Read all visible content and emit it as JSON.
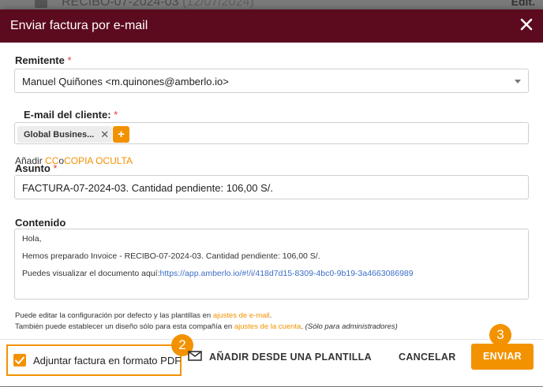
{
  "background": {
    "title": "RECIBO-07-2024-03",
    "date": "(12/07/2024)",
    "right_label": "Edit."
  },
  "modal": {
    "title": "Enviar factura por e-mail",
    "header_color": "#5c0a1e"
  },
  "form": {
    "sender": {
      "label": "Remitente",
      "required_mark": "*",
      "value": "Manuel Quiñones <m.quinones@amberlo.io>"
    },
    "client_email": {
      "label": "E-mail del cliente:",
      "required_mark": "*",
      "chip": "Global Busines...",
      "chip_remove": "✕",
      "add_symbol": "+"
    },
    "cc_line": {
      "prefix": "Añadir",
      "cc": "CC",
      "or": "o",
      "bcc": "COPIA OCULTA"
    },
    "subject": {
      "label": "Asunto",
      "required_mark": "*",
      "value": "FACTURA-07-2024-03. Cantidad pendiente: 106,00 S/."
    },
    "content": {
      "label": "Contenido",
      "greeting": "Hola,",
      "body": "Hemos preparado Invoice - RECIBO-07-2024-03. Cantidad pendiente: 106,00 S/.",
      "link_prefix": "Puedes visualizar el documento aquí:",
      "link_url": "https://app.amberlo.io/#!/i/418d7d15-8309-4bc0-9b19-3a4663086989"
    }
  },
  "notes": {
    "line1_prefix": "Puede editar la configuración por defecto y las plantillas en",
    "line1_link": "ajustes de e-mail",
    "line1_suffix": ".",
    "line2_prefix": "También puede establecer un diseño sólo para esta compañía en",
    "line2_link": "ajustes de la cuenta",
    "line2_suffix": ". ",
    "line2_italic": "(Sólo para administradores)"
  },
  "footer": {
    "attach_label": "Adjuntar factura en formato PDF",
    "attach_checked": true,
    "step_attach": "2",
    "template_button": "AÑADIR DESDE UNA PLANTILLA",
    "cancel_button": "CANCELAR",
    "send_button": "ENVIAR",
    "step_send": "3"
  },
  "colors": {
    "accent": "#f39200",
    "required": "#e53935",
    "link_blue": "#3b6ec7"
  }
}
